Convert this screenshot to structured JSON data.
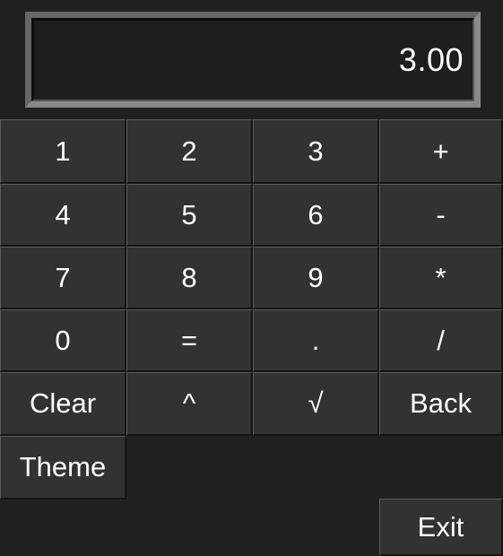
{
  "display": {
    "value": "3.00"
  },
  "keypad": {
    "rows": [
      [
        "1",
        "2",
        "3",
        "+"
      ],
      [
        "4",
        "5",
        "6",
        "-"
      ],
      [
        "7",
        "8",
        "9",
        "*"
      ],
      [
        "0",
        "=",
        ".",
        "/"
      ],
      [
        "Clear",
        "^",
        "√",
        "Back"
      ]
    ]
  },
  "theme_label": "Theme",
  "exit_label": "Exit"
}
